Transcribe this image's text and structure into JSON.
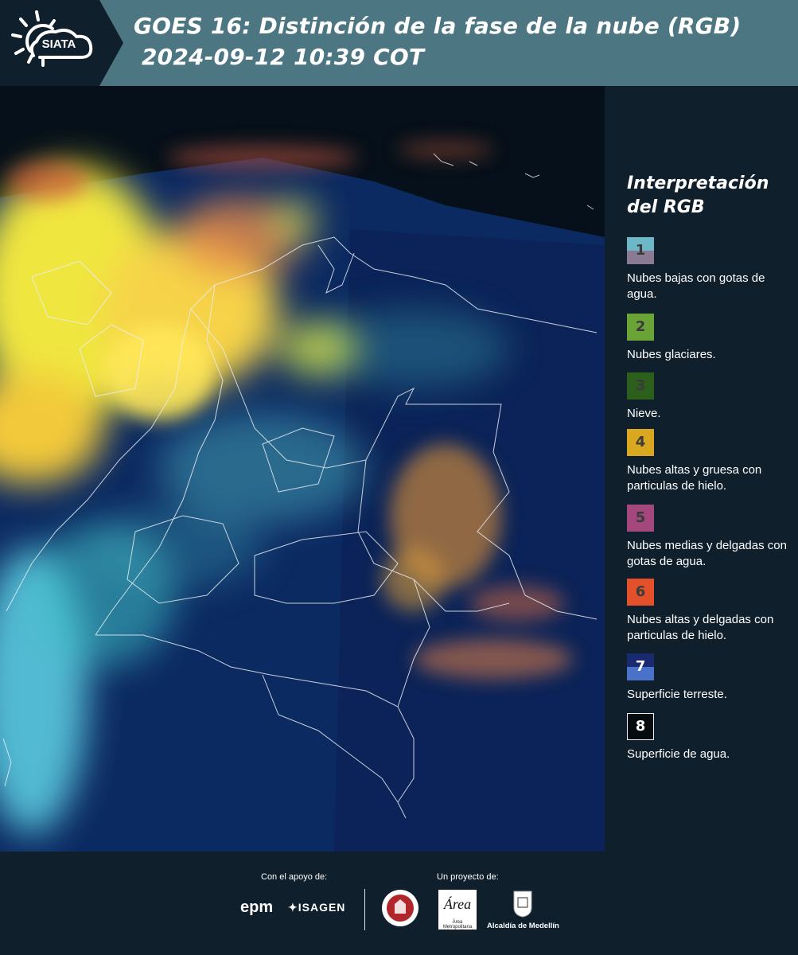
{
  "header": {
    "logo_text": "SIATA",
    "title_line1": "GOES 16: Distinción de la fase de la nube (RGB)",
    "title_line2": "2024-09-12 10:39 COT"
  },
  "map": {
    "background_color": "#0a1f4e"
  },
  "legend": {
    "title": "Interpretación del RGB",
    "items": [
      {
        "number": "1",
        "label": "Nubes bajas con gotas de agua.",
        "color_top": "#6cb8c7",
        "color_bottom": "#8a7a93"
      },
      {
        "number": "2",
        "label": "Nubes glaciares.",
        "color_top": "#6aa437",
        "color_bottom": "#6aa437"
      },
      {
        "number": "3",
        "label": "Nieve.",
        "color_top": "#2d5f1c",
        "color_bottom": "#2d5f1c"
      },
      {
        "number": "4",
        "label": "Nubes altas y gruesa con particulas de hielo.",
        "color_top": "#d9a81f",
        "color_bottom": "#d9a81f"
      },
      {
        "number": "5",
        "label": "Nubes medias y delgadas con gotas de agua.",
        "color_top": "#a4477c",
        "color_bottom": "#a4477c"
      },
      {
        "number": "6",
        "label": "Nubes altas y delgadas con particulas de hielo.",
        "color_top": "#e3502a",
        "color_bottom": "#e3502a"
      },
      {
        "number": "7",
        "label": "Superficie terreste.",
        "color_top": "#1a2a70",
        "color_bottom": "#4a72c8"
      },
      {
        "number": "8",
        "label": "Superficie de agua.",
        "color_top": "#050c0f",
        "color_bottom": "#050c0f"
      }
    ]
  },
  "footer": {
    "support_label": "Con el apoyo de:",
    "project_label": "Un proyecto de:",
    "sponsors": [
      "epm",
      "ISAGEN"
    ],
    "partners": [
      "Área Metropolitana Valle de Aburrá",
      "Alcaldía de Medellín"
    ]
  }
}
